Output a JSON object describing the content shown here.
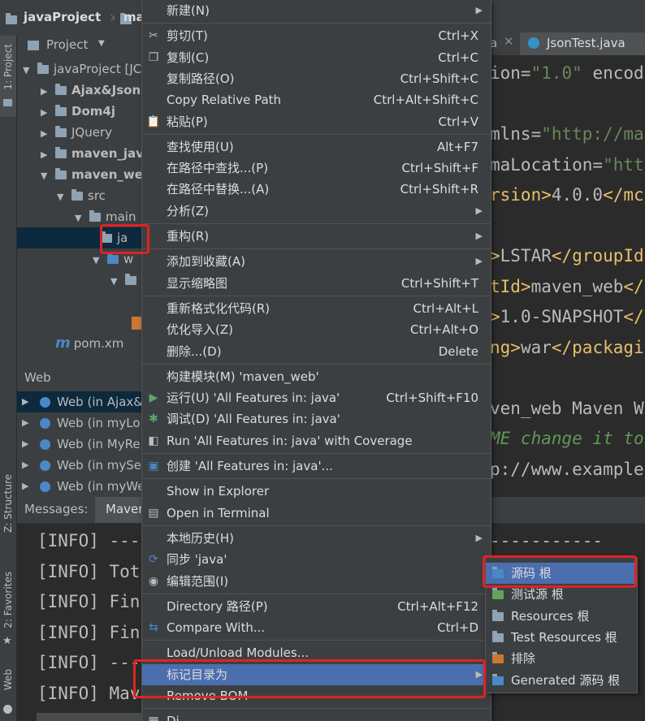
{
  "navbar": {
    "project": "javaProject",
    "module_partial": "ma"
  },
  "left_strip": {
    "project_tab": "1: Project",
    "structure_tab": "Z: Structure",
    "favorites_tab": "2: Favorites",
    "web_tab": "Web"
  },
  "project_panel": {
    "title": "Project",
    "tree": [
      {
        "label": "javaProject [JC",
        "bold": false
      },
      {
        "label": "Ajax&Json",
        "bold": true
      },
      {
        "label": "Dom4j",
        "bold": true
      },
      {
        "label": "JQuery",
        "bold": false
      },
      {
        "label": "maven_jav",
        "bold": true
      },
      {
        "label": "maven_we",
        "bold": true
      },
      {
        "label": "src",
        "bold": false
      },
      {
        "label": "main",
        "bold": false
      },
      {
        "label": "ja",
        "bold": false
      },
      {
        "label": "w",
        "bold": false
      },
      {
        "label": "",
        "bold": false
      },
      {
        "label": "pom.xm",
        "bold": false
      }
    ]
  },
  "web_panel": {
    "title": "Web",
    "items": [
      "Web (in Ajax&",
      "Web (in myLo",
      "Web (in MyRe",
      "Web (in mySe",
      "Web (in myWe"
    ]
  },
  "messages_panel": {
    "tabs": [
      "Messages:",
      "Maver"
    ],
    "lines": [
      "[INFO] ---",
      "[INFO] Tot",
      "[INFO] Fin",
      "[INFO] Fin",
      "[INFO] ---",
      "[INFO] Mav"
    ],
    "right_dashes": "-----------"
  },
  "editor": {
    "tabs": [
      "a",
      "JsonTest.java"
    ],
    "lines": [
      {
        "parts": [
          [
            "ion=",
            "#bababa"
          ],
          [
            "\"1.0\"",
            "#6a8759"
          ],
          [
            " encod",
            "#bababa"
          ]
        ]
      },
      {
        "parts": []
      },
      {
        "parts": [
          [
            "mlns=",
            "#bababa"
          ],
          [
            "\"http://ma",
            "#6a8759"
          ]
        ]
      },
      {
        "parts": [
          [
            "maLocation=",
            "#bababa"
          ],
          [
            "\"htt",
            "#6a8759"
          ]
        ]
      },
      {
        "parts": [
          [
            "rsion>",
            "#e8bf6a"
          ],
          [
            "4.0.0",
            "#bababa"
          ],
          [
            "</mc",
            "#e8bf6a"
          ]
        ]
      },
      {
        "parts": []
      },
      {
        "parts": [
          [
            ">",
            "#e8bf6a"
          ],
          [
            "LSTAR",
            "#bababa"
          ],
          [
            "</groupId",
            "#e8bf6a"
          ]
        ]
      },
      {
        "parts": [
          [
            "tId>",
            "#e8bf6a"
          ],
          [
            "maven_web",
            "#bababa"
          ],
          [
            "</",
            "#e8bf6a"
          ]
        ]
      },
      {
        "parts": [
          [
            ">",
            "#e8bf6a"
          ],
          [
            "1.0-SNAPSHOT",
            "#bababa"
          ],
          [
            "</",
            "#e8bf6a"
          ]
        ]
      },
      {
        "parts": [
          [
            "ng>",
            "#e8bf6a"
          ],
          [
            "war",
            "#bababa"
          ],
          [
            "</packagi",
            "#e8bf6a"
          ]
        ]
      },
      {
        "parts": []
      },
      {
        "parts": [
          [
            "ven_web Maven W",
            "#bababa"
          ]
        ]
      },
      {
        "parts": [
          [
            "ME change it to",
            "#629755"
          ]
        ]
      },
      {
        "parts": [
          [
            "p://www.example",
            "#bababa"
          ]
        ]
      }
    ]
  },
  "context_menu": {
    "items": [
      {
        "label": "新建(N)",
        "shortcut": "",
        "submenu": true,
        "icon": ""
      },
      {
        "sep": true
      },
      {
        "label": "剪切(T)",
        "shortcut": "Ctrl+X",
        "icon": "scissors-icon",
        "glyph": "✂"
      },
      {
        "label": "复制(C)",
        "shortcut": "Ctrl+C",
        "icon": "copy-icon",
        "glyph": "❐"
      },
      {
        "label": "复制路径(O)",
        "shortcut": "Ctrl+Shift+C",
        "icon": ""
      },
      {
        "label": "Copy Relative Path",
        "shortcut": "Ctrl+Alt+Shift+C",
        "icon": ""
      },
      {
        "label": "粘贴(P)",
        "shortcut": "Ctrl+V",
        "icon": "paste-icon",
        "glyph": "📋"
      },
      {
        "sep": true
      },
      {
        "label": "查找使用(U)",
        "shortcut": "Alt+F7",
        "icon": ""
      },
      {
        "label": "在路径中查找...(P)",
        "shortcut": "Ctrl+Shift+F",
        "icon": ""
      },
      {
        "label": "在路径中替换...(A)",
        "shortcut": "Ctrl+Shift+R",
        "icon": ""
      },
      {
        "label": "分析(Z)",
        "shortcut": "",
        "submenu": true,
        "icon": ""
      },
      {
        "sep": true
      },
      {
        "label": "重构(R)",
        "shortcut": "",
        "submenu": true,
        "icon": ""
      },
      {
        "sep": true
      },
      {
        "label": "添加到收藏(A)",
        "shortcut": "",
        "submenu": true,
        "icon": ""
      },
      {
        "label": "显示缩略图",
        "shortcut": "Ctrl+Shift+T",
        "icon": ""
      },
      {
        "sep": true
      },
      {
        "label": "重新格式化代码(R)",
        "shortcut": "Ctrl+Alt+L",
        "icon": ""
      },
      {
        "label": "优化导入(Z)",
        "shortcut": "Ctrl+Alt+O",
        "icon": ""
      },
      {
        "label": "删除...(D)",
        "shortcut": "Delete",
        "icon": ""
      },
      {
        "sep": true
      },
      {
        "label": "构建模块(M) 'maven_web'",
        "shortcut": "",
        "icon": ""
      },
      {
        "label": "运行(U) 'All Features in: java'",
        "shortcut": "Ctrl+Shift+F10",
        "icon": "run-icon",
        "glyph": "▶"
      },
      {
        "label": "调试(D) 'All Features in: java'",
        "shortcut": "",
        "icon": "debug-icon",
        "glyph": "✱"
      },
      {
        "label": "Run 'All Features in: java' with Coverage",
        "shortcut": "",
        "icon": "coverage-icon",
        "glyph": "◧"
      },
      {
        "sep": true
      },
      {
        "label": "创建 'All Features in: java'...",
        "shortcut": "",
        "icon": "create-config-icon",
        "glyph": "▣"
      },
      {
        "sep": true
      },
      {
        "label": "Show in Explorer",
        "shortcut": "",
        "icon": ""
      },
      {
        "label": "Open in Terminal",
        "shortcut": "",
        "icon": "terminal-icon",
        "glyph": "▤"
      },
      {
        "sep": true
      },
      {
        "label": "本地历史(H)",
        "shortcut": "",
        "submenu": true,
        "icon": ""
      },
      {
        "label": "同步 'java'",
        "shortcut": "",
        "icon": "sync-icon",
        "glyph": "⟳"
      },
      {
        "label": "编辑范围(I)",
        "shortcut": "",
        "icon": "scope-icon",
        "glyph": "◉"
      },
      {
        "sep": true
      },
      {
        "label": "Directory 路径(P)",
        "shortcut": "Ctrl+Alt+F12",
        "icon": ""
      },
      {
        "label": "Compare With...",
        "shortcut": "Ctrl+D",
        "icon": "compare-icon",
        "glyph": "⇆"
      },
      {
        "sep": true
      },
      {
        "label": "Load/Unload Modules...",
        "shortcut": "",
        "icon": ""
      },
      {
        "label": "标记目录为",
        "shortcut": "",
        "submenu": true,
        "icon": "",
        "highlight": true
      },
      {
        "label": "Remove BOM",
        "shortcut": "",
        "icon": ""
      },
      {
        "sep": true
      },
      {
        "label": "Di",
        "shortcut": "",
        "icon": "diagram-icon",
        "glyph": "▦"
      }
    ]
  },
  "submenu": {
    "items": [
      {
        "label": "源码 根",
        "color": "#4a88c7",
        "highlight": true,
        "icon": "source-root-folder-icon"
      },
      {
        "label": "测试源 根",
        "color": "#62a35a",
        "icon": "test-source-root-folder-icon"
      },
      {
        "label": "Resources 根",
        "color": "#8fa3b5",
        "icon": "resources-root-folder-icon"
      },
      {
        "label": "Test Resources 根",
        "color": "#8fa3b5",
        "icon": "test-resources-root-folder-icon"
      },
      {
        "label": "排除",
        "color": "#cc7832",
        "icon": "excluded-folder-icon"
      },
      {
        "label": "Generated 源码 根",
        "color": "#4a88c7",
        "icon": "generated-source-root-folder-icon"
      }
    ]
  },
  "colors": {
    "menu_highlight": "#4b6eaf",
    "annotation_red": "#e02222"
  }
}
